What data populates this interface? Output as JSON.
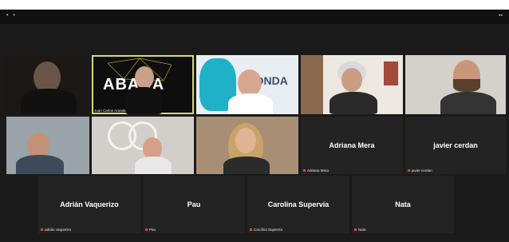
{
  "window": {
    "title": "",
    "controls": "• •",
    "right_controls": "▪▪"
  },
  "participants": [
    {
      "id": "p1",
      "label": ""
    },
    {
      "id": "p2",
      "label": "Juan Carlos Aranda",
      "banner": "ABADA"
    },
    {
      "id": "p3",
      "label": "",
      "banner": "MONDA"
    },
    {
      "id": "p4",
      "label": ""
    },
    {
      "id": "p5",
      "label": "",
      "sublabel": ""
    },
    {
      "id": "p6",
      "label": ""
    },
    {
      "id": "p7",
      "label": ""
    },
    {
      "id": "p8",
      "label": ""
    },
    {
      "id": "p9",
      "name": "Adriana Mera",
      "label": "Adriana Mera"
    },
    {
      "id": "p10",
      "name": "javier cerdan",
      "label": "javier cerdan"
    },
    {
      "id": "p11",
      "name": "Adrián Vaquerizo",
      "label": "adrián vaquerizo"
    },
    {
      "id": "p12",
      "name": "Pau",
      "label": "Pau"
    },
    {
      "id": "p13",
      "name": "Carolina Supervía",
      "label": "Carolina Supervía"
    },
    {
      "id": "p14",
      "name": "Nata",
      "label": "Nata"
    }
  ],
  "colors": {
    "mic_muted": "#e8443a",
    "active_speaker": "#d7d77a",
    "tile_bg": "#232323"
  }
}
